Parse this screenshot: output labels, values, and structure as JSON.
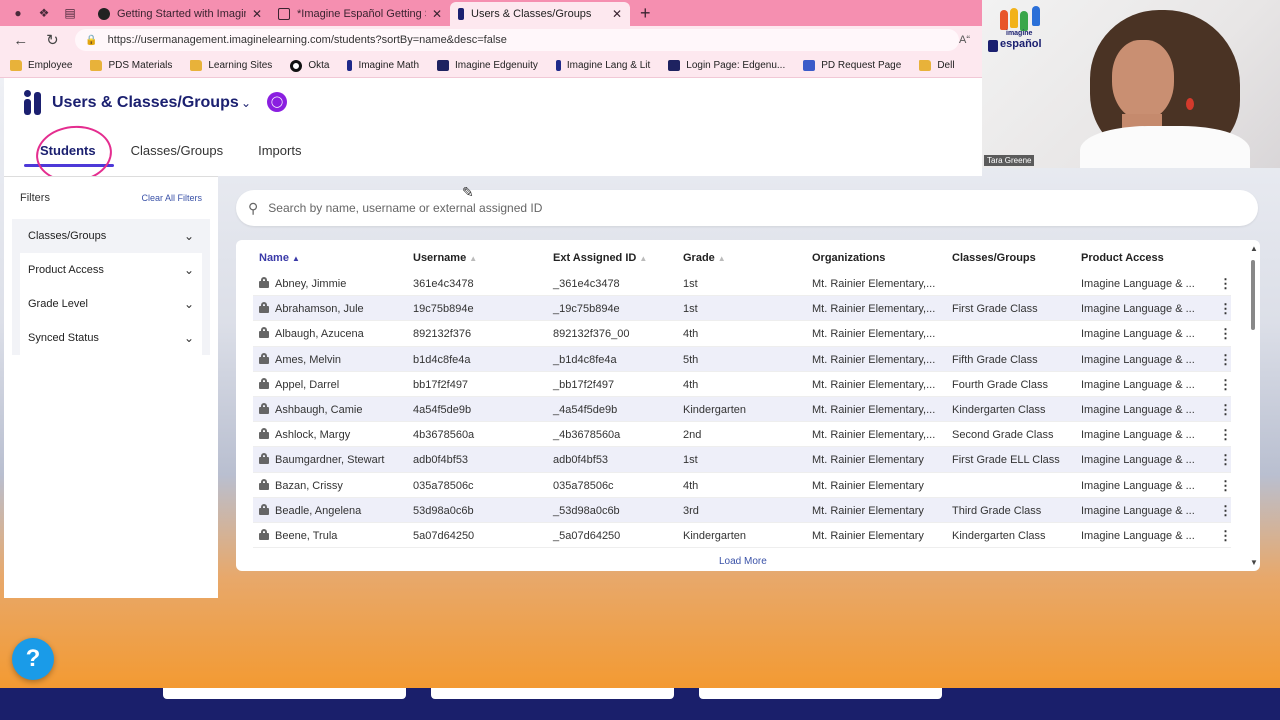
{
  "browser": {
    "tabs": [
      {
        "title": "Getting Started with Imagine Esp",
        "active": false
      },
      {
        "title": "*Imagine Español Getting Starte",
        "active": false
      },
      {
        "title": "Users & Classes/Groups",
        "active": true
      }
    ],
    "url": "https://usermanagement.imaginelearning.com/students?sortBy=name&desc=false",
    "bookmarks": [
      "Employee",
      "PDS Materials",
      "Learning Sites",
      "Okta",
      "Imagine Math",
      "Imagine Edgenuity",
      "Imagine Lang & Lit",
      "Login Page: Edgenu...",
      "PD Request Page",
      "Dell"
    ]
  },
  "app": {
    "title": "Users & Classes/Groups",
    "tabs": [
      "Students",
      "Classes/Groups",
      "Imports"
    ]
  },
  "filters": {
    "title": "Filters",
    "clear_all": "Clear All Filters",
    "items": [
      "Classes/Groups",
      "Product Access",
      "Grade Level",
      "Synced Status"
    ]
  },
  "search": {
    "placeholder": "Search by name, username or external assigned ID"
  },
  "table": {
    "columns": [
      "Name",
      "Username",
      "Ext Assigned ID",
      "Grade",
      "Organizations",
      "Classes/Groups",
      "Product Access"
    ],
    "rows": [
      [
        "Abney, Jimmie",
        "361e4c3478",
        "_361e4c3478",
        "1st",
        "Mt. Rainier Elementary,...",
        "",
        "Imagine Language & ..."
      ],
      [
        "Abrahamson, Jule",
        "19c75b894e",
        "_19c75b894e",
        "1st",
        "Mt. Rainier Elementary,...",
        "First Grade Class",
        "Imagine Language & ..."
      ],
      [
        "Albaugh, Azucena",
        "892132f376",
        "892132f376_00",
        "4th",
        "Mt. Rainier Elementary,...",
        "",
        "Imagine Language & ..."
      ],
      [
        "Ames, Melvin",
        "b1d4c8fe4a",
        "_b1d4c8fe4a",
        "5th",
        "Mt. Rainier Elementary,...",
        "Fifth Grade Class",
        "Imagine Language & ..."
      ],
      [
        "Appel, Darrel",
        "bb17f2f497",
        "_bb17f2f497",
        "4th",
        "Mt. Rainier Elementary,...",
        "Fourth Grade Class",
        "Imagine Language & ..."
      ],
      [
        "Ashbaugh, Camie",
        "4a54f5de9b",
        "_4a54f5de9b",
        "Kindergarten",
        "Mt. Rainier Elementary,...",
        "Kindergarten Class",
        "Imagine Language & ..."
      ],
      [
        "Ashlock, Margy",
        "4b3678560a",
        "_4b3678560a",
        "2nd",
        "Mt. Rainier Elementary,...",
        "Second Grade Class",
        "Imagine Language & ..."
      ],
      [
        "Baumgardner, Stewart",
        "adb0f4bf53",
        "adb0f4bf53",
        "1st",
        "Mt. Rainier Elementary",
        "First Grade ELL Class",
        "Imagine Language & ..."
      ],
      [
        "Bazan, Crissy",
        "035a78506c",
        "035a78506c",
        "4th",
        "Mt. Rainier Elementary",
        "",
        "Imagine Language & ..."
      ],
      [
        "Beadle, Angelena",
        "53d98a0c6b",
        "_53d98a0c6b",
        "3rd",
        "Mt. Rainier Elementary",
        "Third Grade Class",
        "Imagine Language & ..."
      ],
      [
        "Beene, Trula",
        "5a07d64250",
        "_5a07d64250",
        "Kindergarten",
        "Mt. Rainier Elementary",
        "Kindergarten Class",
        "Imagine Language & ..."
      ]
    ],
    "load_more": "Load More"
  },
  "help": {
    "label": "?"
  },
  "webcam": {
    "logo_line1": "imagine",
    "logo_line2": "español",
    "name": "Tara Greene"
  },
  "colors": {
    "brand": "#1b2070",
    "accent": "#4d39d8",
    "browser_tabbar": "#f58fb0",
    "annotation": "#e42d8f",
    "help": "#1a9be8"
  }
}
